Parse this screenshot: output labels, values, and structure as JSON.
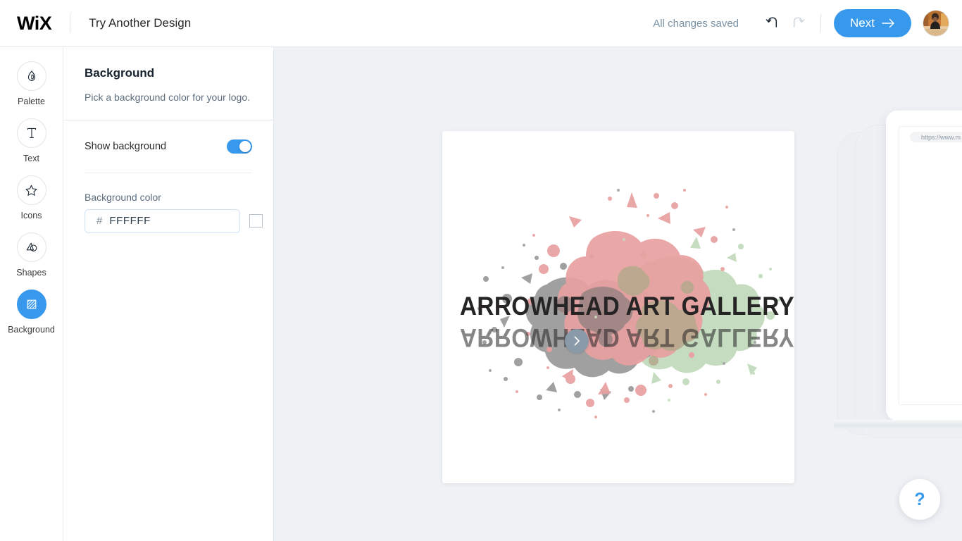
{
  "topbar": {
    "brand": "WiX",
    "page_title": "Try Another Design",
    "save_status": "All changes saved",
    "undo_icon": "undo-arrow-icon",
    "redo_icon": "redo-arrow-icon",
    "next_label": "Next",
    "next_arrow": "→",
    "avatar_name": "user-avatar",
    "accent_color": "#3899ec"
  },
  "rail": {
    "items": [
      {
        "label": "Palette",
        "icon": "droplet-icon",
        "active": false
      },
      {
        "label": "Text",
        "icon": "text-t-icon",
        "active": false
      },
      {
        "label": "Icons",
        "icon": "star-icon",
        "active": false
      },
      {
        "label": "Shapes",
        "icon": "shapes-icon",
        "active": false
      },
      {
        "label": "Background",
        "icon": "hatched-square-icon",
        "active": true
      }
    ]
  },
  "panel": {
    "title": "Background",
    "subtitle": "Pick a background color for your logo.",
    "show_background_label": "Show background",
    "show_background_on": true,
    "background_color_label": "Background color",
    "hash_symbol": "#",
    "hex_value": "FFFFFF",
    "hex_placeholder": "FFFFFF",
    "swatch_color": "#FFFFFF"
  },
  "canvas": {
    "background_color": "#eff2f5",
    "logo": {
      "card_background": "#FFFFFF",
      "text": "ARROWHEAD ART GALLERY",
      "reflection_text": "ARROWHEAD ART GALLERY",
      "text_color": "#262425",
      "reflection_color": "#262425",
      "splatter_colors": [
        "#e8a0a0",
        "#a0a0a0",
        "#c5dcc0",
        "#b5a88c",
        "#8f7f7f"
      ]
    },
    "carousel_next_icon": "chevron-right-icon",
    "carousel_next_color": "#8b9aa8",
    "mockup_url": "https://www.m",
    "help_label": "?",
    "help_color": "#3899ec"
  }
}
